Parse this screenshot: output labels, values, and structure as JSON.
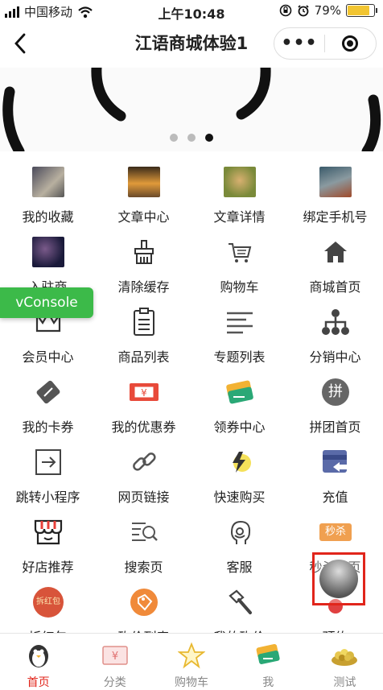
{
  "status": {
    "carrier": "中国移动",
    "time": "上午10:48",
    "battery": "79%"
  },
  "nav": {
    "title": "江语商城体验1",
    "back": "<",
    "more": "•••"
  },
  "banner": {
    "pages": 3,
    "active": 3
  },
  "grid": [
    {
      "label": "我的收藏",
      "icon": "photo-dogs-icon"
    },
    {
      "label": "文章中心",
      "icon": "photo-sunset-icon"
    },
    {
      "label": "文章详情",
      "icon": "photo-puppy-icon"
    },
    {
      "label": "绑定手机号",
      "icon": "photo-path-icon"
    },
    {
      "label": "入驻商",
      "icon": "photo-galaxy-icon"
    },
    {
      "label": "清除缓存",
      "icon": "broom-icon"
    },
    {
      "label": "购物车",
      "icon": "cart-icon"
    },
    {
      "label": "商城首页",
      "icon": "home-icon"
    },
    {
      "label": "会员中心",
      "icon": "crown-icon"
    },
    {
      "label": "商品列表",
      "icon": "clipboard-icon"
    },
    {
      "label": "专题列表",
      "icon": "list-lines-icon"
    },
    {
      "label": "分销中心",
      "icon": "org-tree-icon"
    },
    {
      "label": "我的卡券",
      "icon": "ticket-icon"
    },
    {
      "label": "我的优惠券",
      "icon": "coupon-icon"
    },
    {
      "label": "领券中心",
      "icon": "coupon-stack-icon"
    },
    {
      "label": "拼团首页",
      "icon": "group-buy-icon",
      "glyph": "拼"
    },
    {
      "label": "跳转小程序",
      "icon": "jump-icon"
    },
    {
      "label": "网页链接",
      "icon": "link-icon"
    },
    {
      "label": "快速购买",
      "icon": "lightning-icon"
    },
    {
      "label": "充值",
      "icon": "recharge-icon"
    },
    {
      "label": "好店推荐",
      "icon": "shop-icon"
    },
    {
      "label": "搜索页",
      "icon": "search-list-icon"
    },
    {
      "label": "客服",
      "icon": "customer-service-icon"
    },
    {
      "label": "秒杀首页",
      "icon": "flash-sale-icon",
      "glyph": "秒杀"
    },
    {
      "label": "拆红包",
      "icon": "red-packet-icon",
      "glyph": "拆红包"
    },
    {
      "label": "砍价列表",
      "icon": "bargain-icon"
    },
    {
      "label": "我的砍价",
      "icon": "hammer-icon"
    },
    {
      "label": "预约",
      "icon": "reserve-icon"
    }
  ],
  "coupon_glyph": "¥",
  "vconsole": "vConsole",
  "tabs": [
    {
      "label": "首页",
      "icon": "penguin-icon",
      "active": true
    },
    {
      "label": "分类",
      "icon": "coupon-tab-icon",
      "glyph": "¥"
    },
    {
      "label": "购物车",
      "icon": "star-icon"
    },
    {
      "label": "我",
      "icon": "tickets-tab-icon"
    },
    {
      "label": "测试",
      "icon": "food-icon"
    }
  ],
  "colors": {
    "accent": "#e1251b",
    "vconsole": "#3cba49",
    "battery": "#f2c531"
  }
}
